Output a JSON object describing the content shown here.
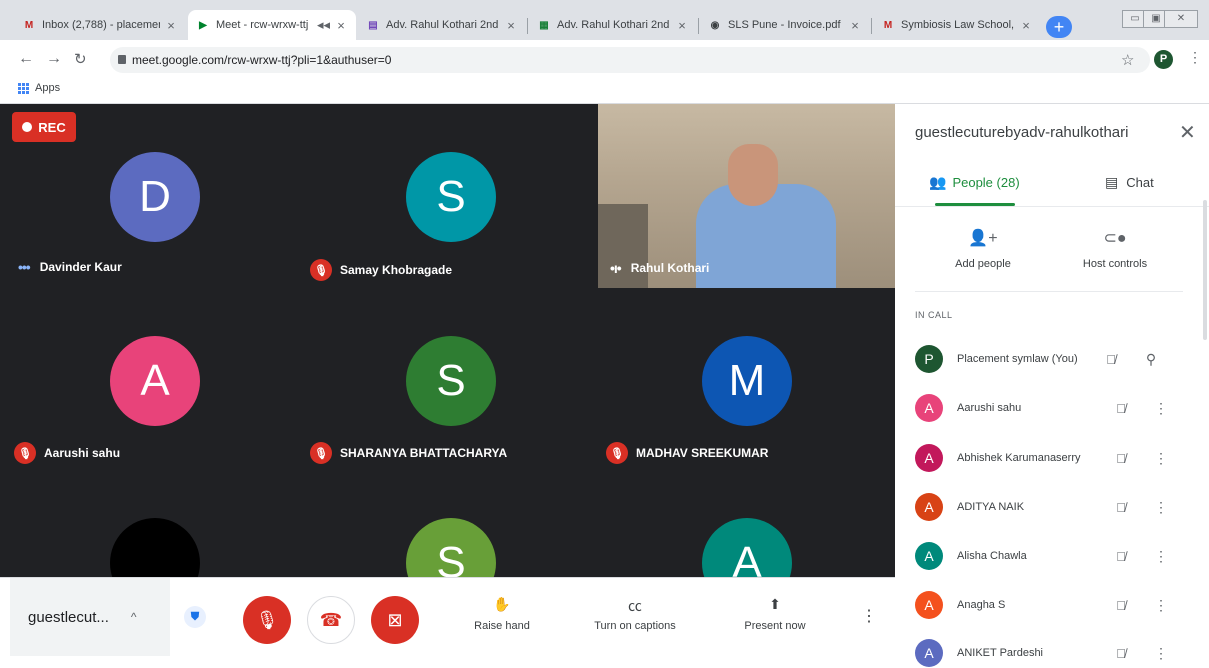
{
  "browser": {
    "tabs": [
      {
        "title": "Inbox (2,788) - placemen",
        "icon": "M",
        "color": "#c5221f"
      },
      {
        "title": "Meet - rcw-wrxw-ttj",
        "icon": "▶",
        "color": "#00832d"
      },
      {
        "title": "Adv. Rahul Kothari 2nd",
        "icon": "▤",
        "color": "#7248b9"
      },
      {
        "title": "Adv. Rahul Kothari 2nd",
        "icon": "▦",
        "color": "#188038"
      },
      {
        "title": "SLS Pune - Invoice.pdf",
        "icon": "◉",
        "color": "#3c4043"
      },
      {
        "title": "Symbiosis Law School, P",
        "icon": "M",
        "color": "#c5221f"
      }
    ],
    "url": "meet.google.com/rcw-wrxw-ttj?pli=1&authuser=0",
    "profile_initial": "P",
    "bookmarks_apps": "Apps"
  },
  "meet": {
    "rec_label": "REC",
    "participants": [
      {
        "initial": "D",
        "name": "Davinder Kaur",
        "color": "#5c6bc0",
        "muted": false
      },
      {
        "initial": "S",
        "name": "Samay Khobragade",
        "color": "#0097a7",
        "muted": true
      },
      {
        "initial": "",
        "name": "Rahul Kothari",
        "color": "#000000",
        "muted": false
      },
      {
        "initial": "A",
        "name": "Aarushi sahu",
        "color": "#e8437a",
        "muted": true
      },
      {
        "initial": "S",
        "name": "SHARANYA BHATTACHARYA",
        "color": "#2e7d32",
        "muted": true
      },
      {
        "initial": "M",
        "name": "MADHAV SREEKUMAR",
        "color": "#0d56b3",
        "muted": true
      },
      {
        "initial": "",
        "name": "",
        "color": "#000000",
        "muted": false
      },
      {
        "initial": "S",
        "name": "",
        "color": "#689f38",
        "muted": false
      },
      {
        "initial": "A",
        "name": "",
        "color": "#00897b",
        "muted": false
      }
    ],
    "meeting_title": "guestlecut...",
    "actions": {
      "raise_hand": "Raise hand",
      "captions": "Turn on captions",
      "present": "Present now"
    }
  },
  "panel": {
    "title": "guestlecuturebyadv-rahulkothari",
    "people_tab": "People (28)",
    "chat_tab": "Chat",
    "add_people": "Add people",
    "host_controls": "Host controls",
    "in_call": "IN CALL",
    "people": [
      {
        "initial": "P",
        "name": "Placement symlaw (You)",
        "color": "#1e5631"
      },
      {
        "initial": "A",
        "name": "Aarushi sahu",
        "color": "#e8437a"
      },
      {
        "initial": "A",
        "name": "Abhishek Karumanaserry",
        "color": "#c2185b"
      },
      {
        "initial": "A",
        "name": "ADITYA NAIK",
        "color": "#d84315"
      },
      {
        "initial": "A",
        "name": "Alisha Chawla",
        "color": "#00897b"
      },
      {
        "initial": "A",
        "name": "Anagha S",
        "color": "#f4511e"
      },
      {
        "initial": "A",
        "name": "ANIKET Pardeshi",
        "color": "#5c6bc0"
      }
    ]
  }
}
